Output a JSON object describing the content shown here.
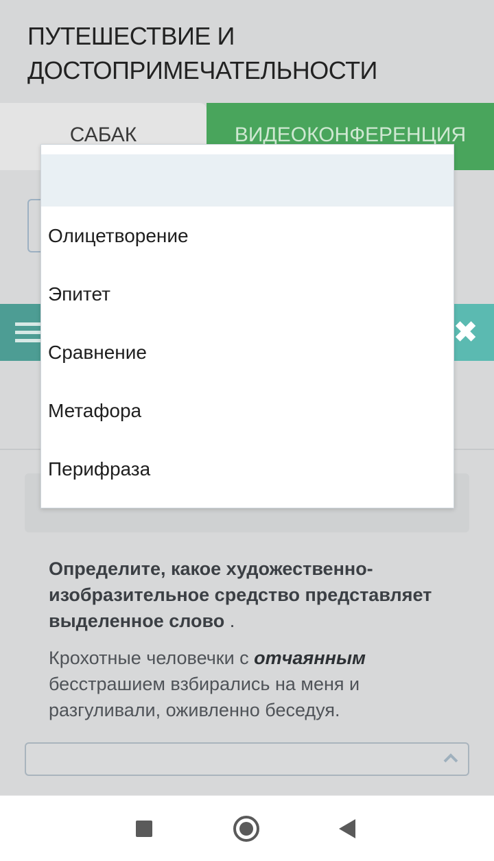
{
  "header": {
    "title": "ПУТЕШЕСТВИЕ И ДОСТОПРИМЕЧАТЕЛЬНОСТИ"
  },
  "tabs": [
    {
      "label": "САБАК"
    },
    {
      "label": "ВИДЕОКОНФЕРЕНЦИЯ"
    }
  ],
  "question": {
    "prompt": "Определите, какое художественно-изобразительное средство представляет выделенное слово",
    "prompt_end": " .",
    "sentence_before": "Крохотные человечки с ",
    "highlighted_word": "отчаянным",
    "sentence_after": " бесстрашием взбирались на меня и разгуливали, оживленно беседуя."
  },
  "dropdown": {
    "options": [
      "",
      "Олицетворение",
      "Эпитет",
      "Сравнение",
      "Метафора",
      "Перифраза"
    ]
  },
  "icons": {
    "menu": "hamburger-icon",
    "close": "close-icon",
    "chevron": "chevron-up-icon",
    "nav_recents": "square-icon",
    "nav_home": "circle-icon",
    "nav_back": "back-triangle-icon"
  },
  "colors": {
    "video_tab": "#49a55c",
    "close_button": "#5bbab1",
    "menu_button": "#4d9d94",
    "dropdown_selected_bg": "#e9f0f4"
  }
}
